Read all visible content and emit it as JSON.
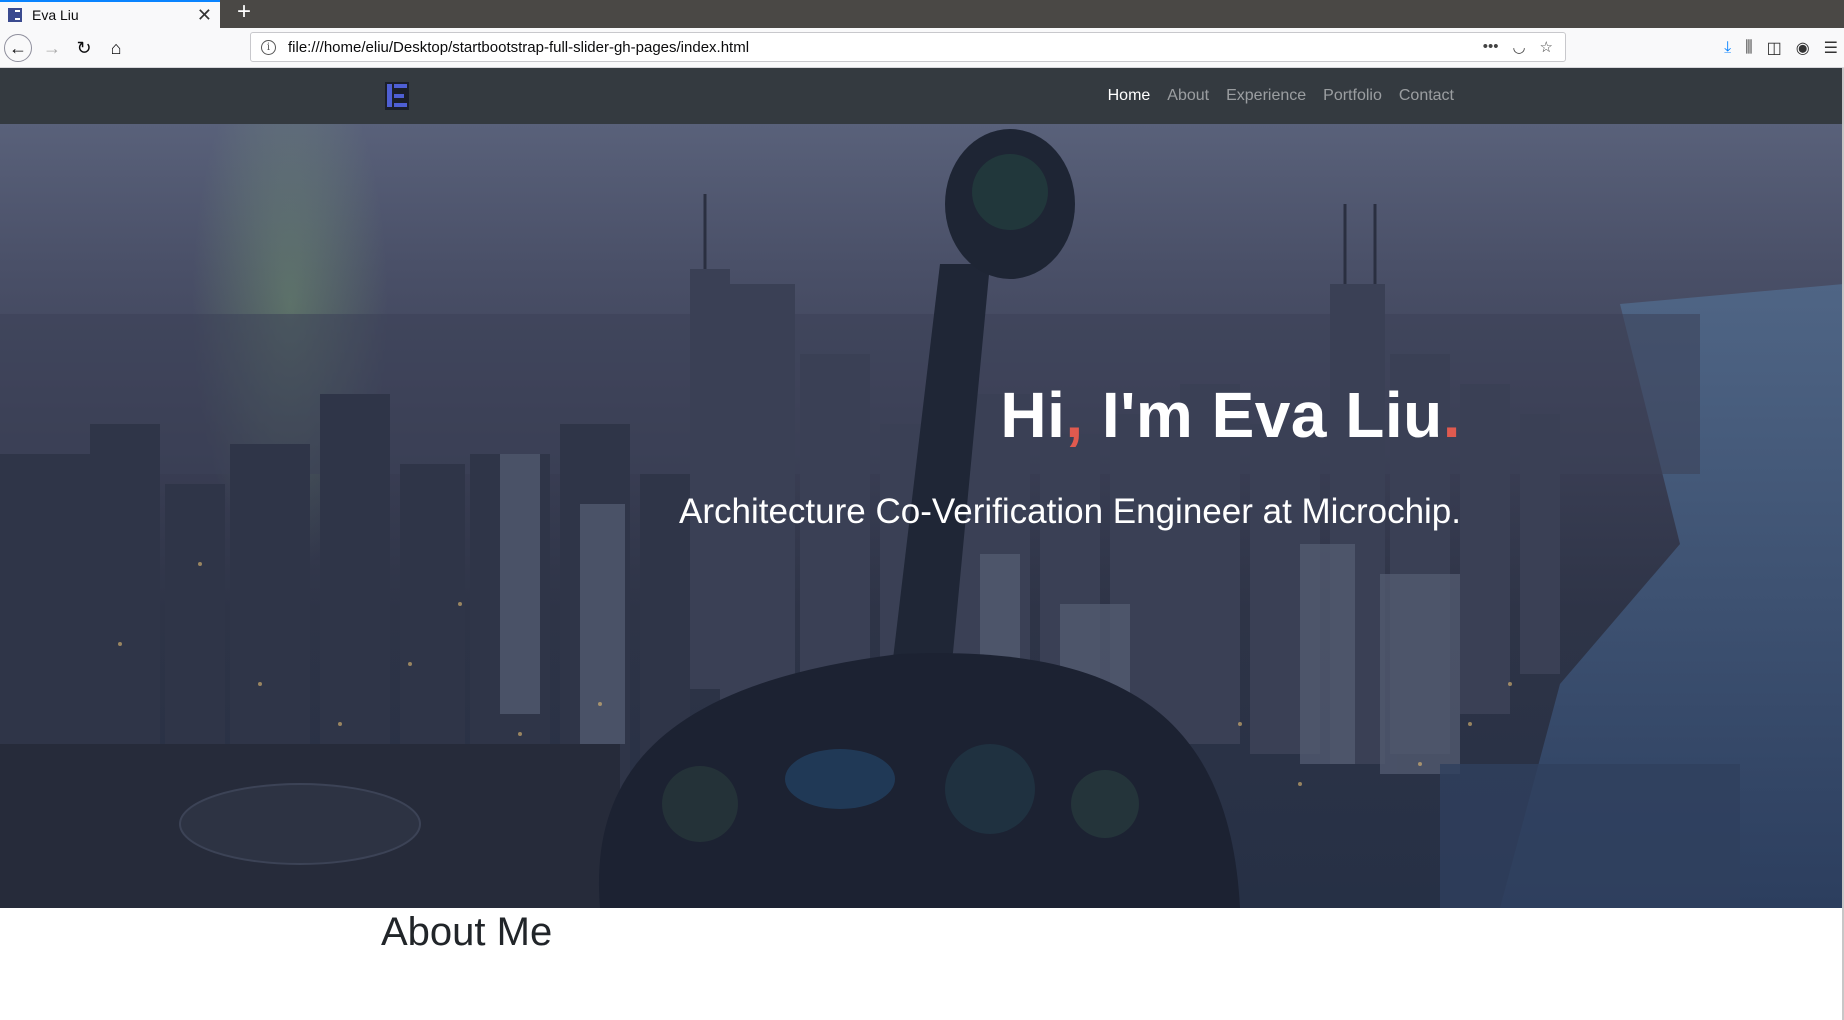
{
  "browser": {
    "tab_title": "Eva Liu",
    "url": "file:///home/eliu/Desktop/startbootstrap-full-slider-gh-pages/index.html",
    "icons": [
      "back-icon",
      "forward-icon",
      "reload-icon",
      "home-icon",
      "info-icon",
      "more-icon",
      "pocket-icon",
      "star-icon",
      "download-icon",
      "library-icon",
      "sidebar-icon",
      "account-icon",
      "menu-icon"
    ]
  },
  "site": {
    "nav": {
      "links": [
        "Home",
        "About",
        "Experience",
        "Portfolio",
        "Contact"
      ],
      "active": "Home"
    },
    "hero": {
      "greeting": "Hi",
      "comma": ",",
      "name_part": " I'm Eva Liu",
      "period": ".",
      "subtitle": "Architecture Co-Verification Engineer at Microchip."
    },
    "about": {
      "heading": "About Me"
    },
    "colors": {
      "navbar": "#343a40",
      "accent": "#e05a4f",
      "logo": "#4e5fd4"
    }
  }
}
